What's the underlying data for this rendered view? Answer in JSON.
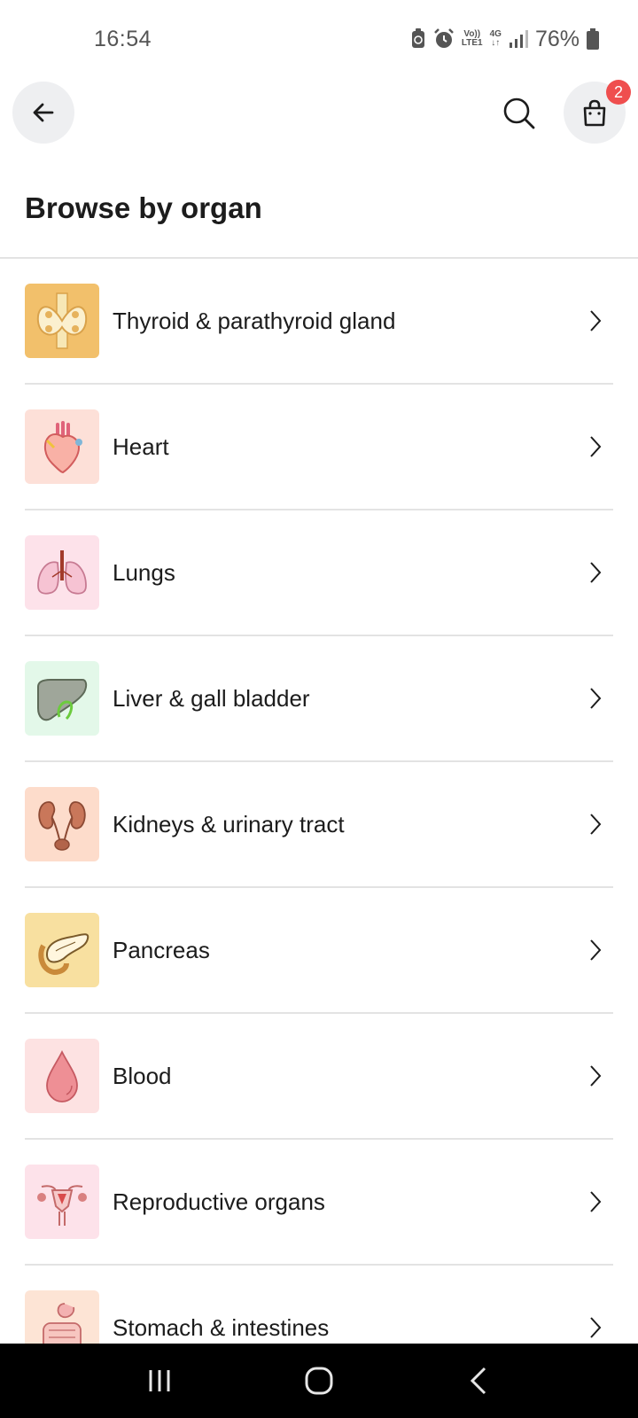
{
  "status_bar": {
    "time": "16:54",
    "network_top": "Vo))",
    "network_bottom": "LTE1",
    "data_type": "4G",
    "battery": "76%"
  },
  "header": {
    "cart_count": "2"
  },
  "page": {
    "title": "Browse by organ"
  },
  "organs": [
    {
      "label": "Thyroid & parathyroid gland",
      "icon": "thyroid-icon",
      "bg": "#f2c06b"
    },
    {
      "label": "Heart",
      "icon": "heart-organ-icon",
      "bg": "#fde0d8"
    },
    {
      "label": "Lungs",
      "icon": "lungs-icon",
      "bg": "#fde2ea"
    },
    {
      "label": "Liver & gall bladder",
      "icon": "liver-icon",
      "bg": "#e3f8e9"
    },
    {
      "label": "Kidneys & urinary tract",
      "icon": "kidneys-icon",
      "bg": "#fddccb"
    },
    {
      "label": "Pancreas",
      "icon": "pancreas-icon",
      "bg": "#f8e0a0"
    },
    {
      "label": "Blood",
      "icon": "blood-drop-icon",
      "bg": "#fde2e2"
    },
    {
      "label": "Reproductive organs",
      "icon": "uterus-icon",
      "bg": "#fde2ea"
    },
    {
      "label": "Stomach & intestines",
      "icon": "intestines-icon",
      "bg": "#fde4d5"
    }
  ]
}
